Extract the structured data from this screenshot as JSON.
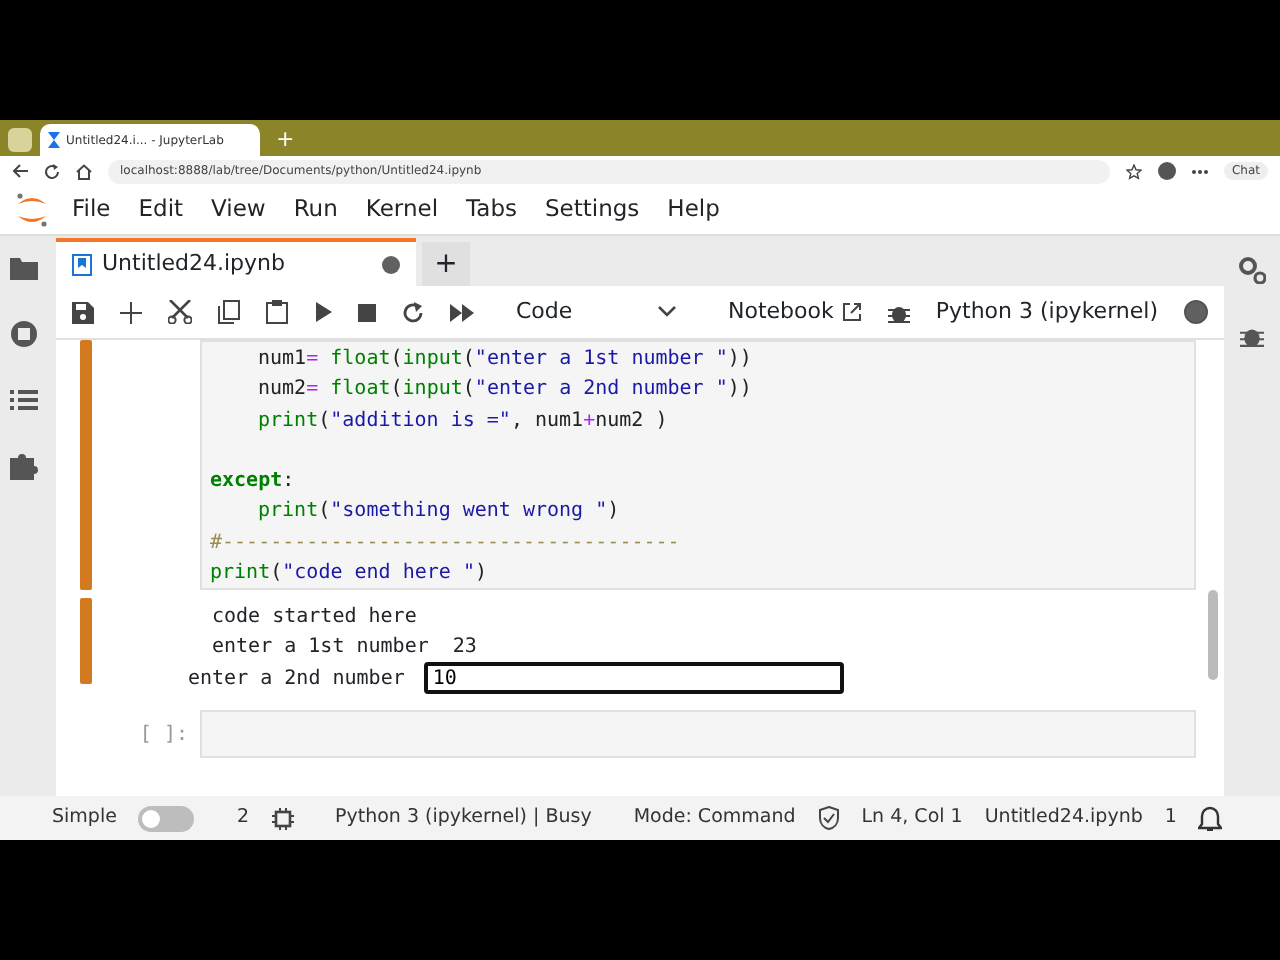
{
  "browser": {
    "tab_title": "Untitled24.i... - JupyterLab",
    "new_tab": "+",
    "url": "localhost:8888/lab/tree/Documents/python/Untitled24.ipynb",
    "chat": "Chat"
  },
  "menu": [
    "File",
    "Edit",
    "View",
    "Run",
    "Kernel",
    "Tabs",
    "Settings",
    "Help"
  ],
  "notebook_tab": {
    "title": "Untitled24.ipynb",
    "unsaved": true,
    "add": "+"
  },
  "toolbar": {
    "cell_type": "Code",
    "notebook": "Notebook",
    "kernel": "Python 3 (ipykernel)",
    "kernel_busy": true
  },
  "code_lines": [
    {
      "indented": true,
      "gap_before": false,
      "tokens": [
        {
          "kind": "plain",
          "text": "num1"
        },
        {
          "kind": "operator",
          "text": "="
        },
        {
          "kind": "builtin",
          "text": " float"
        },
        {
          "kind": "plain",
          "text": "("
        },
        {
          "kind": "builtin",
          "text": "input"
        },
        {
          "kind": "plain",
          "text": "("
        },
        {
          "kind": "string",
          "text": "\"enter a 1st number \""
        },
        {
          "kind": "plain",
          "text": "))"
        }
      ]
    },
    {
      "indented": true,
      "gap_before": false,
      "tokens": [
        {
          "kind": "plain",
          "text": "num2"
        },
        {
          "kind": "operator",
          "text": "="
        },
        {
          "kind": "builtin",
          "text": " float"
        },
        {
          "kind": "plain",
          "text": "("
        },
        {
          "kind": "builtin",
          "text": "input"
        },
        {
          "kind": "plain",
          "text": "("
        },
        {
          "kind": "string",
          "text": "\"enter a 2nd number \""
        },
        {
          "kind": "plain",
          "text": "))"
        }
      ]
    },
    {
      "indented": true,
      "gap_before": false,
      "tokens": [
        {
          "kind": "builtin",
          "text": "print"
        },
        {
          "kind": "plain",
          "text": "("
        },
        {
          "kind": "string",
          "text": "\"addition is =\""
        },
        {
          "kind": "plain",
          "text": ", num1"
        },
        {
          "kind": "operator",
          "text": "+"
        },
        {
          "kind": "plain",
          "text": "num2 )"
        }
      ]
    },
    {
      "indented": false,
      "gap_before": true,
      "tokens": [
        {
          "kind": "keyword",
          "text": "except"
        },
        {
          "kind": "plain",
          "text": ":"
        }
      ]
    },
    {
      "indented": true,
      "gap_before": false,
      "tokens": [
        {
          "kind": "builtin",
          "text": "print"
        },
        {
          "kind": "plain",
          "text": "("
        },
        {
          "kind": "string",
          "text": "\"something went wrong \""
        },
        {
          "kind": "plain",
          "text": ")"
        }
      ]
    },
    {
      "indented": false,
      "gap_before": false,
      "tokens": [
        {
          "kind": "comment",
          "text": "#--------------------------------------"
        }
      ]
    },
    {
      "indented": false,
      "gap_before": false,
      "tokens": [
        {
          "kind": "builtin",
          "text": "print"
        },
        {
          "kind": "plain",
          "text": "("
        },
        {
          "kind": "string",
          "text": "\"code end here \""
        },
        {
          "kind": "plain",
          "text": ")"
        }
      ]
    }
  ],
  "output": {
    "lines": [
      "code started here",
      "enter a 1st number  23"
    ],
    "prompt": "enter a 2nd number ",
    "input_value": "10"
  },
  "empty_cell": {
    "prompt": "[ ]:"
  },
  "status_bar": {
    "mode_label": "Simple",
    "simple_mode": false,
    "terminals": "2",
    "kernel_status": "Python 3 (ipykernel) | Busy",
    "mode": "Mode: Command",
    "position": "Ln 4, Col 1",
    "file": "Untitled24.ipynb",
    "notifications": "1"
  }
}
